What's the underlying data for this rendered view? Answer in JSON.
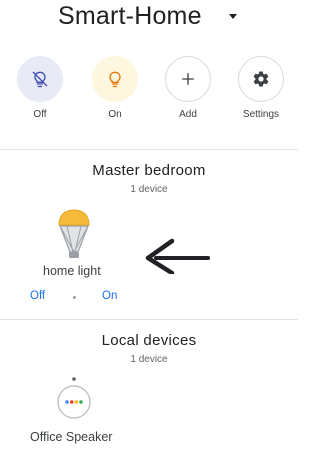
{
  "header": {
    "title": "Smart-Home"
  },
  "actions": [
    {
      "label": "Off",
      "icon": "light-off-icon"
    },
    {
      "label": "On",
      "icon": "light-on-icon"
    },
    {
      "label": "Add",
      "icon": "plus-icon"
    },
    {
      "label": "Settings",
      "icon": "gear-icon"
    }
  ],
  "rooms": [
    {
      "title": "Master bedroom",
      "count": "1 device",
      "device": {
        "name": "home light",
        "icon": "light-bulb-icon",
        "off_label": "Off",
        "on_label": "On"
      }
    },
    {
      "title": "Local devices",
      "count": "1 device",
      "device": {
        "name": "Office Speaker",
        "icon": "smart-speaker-icon"
      }
    }
  ],
  "colors": {
    "accent": "#1a73e8",
    "off_bg": "#e8eaf6",
    "on_bg": "#fef7e0",
    "bulb_on": "#f6ba3a"
  }
}
